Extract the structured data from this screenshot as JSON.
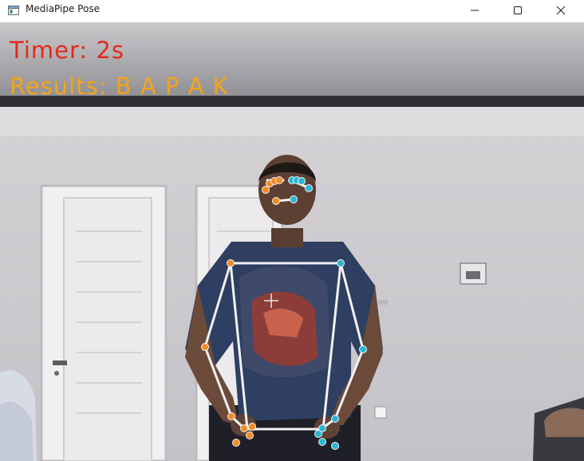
{
  "window": {
    "title": "MediaPipe Pose",
    "icon": "app-window-icon",
    "controls": [
      "minimize-icon",
      "maximize-icon",
      "close-icon"
    ]
  },
  "overlay": {
    "timer_text": "Timer: 2s",
    "results_text": "Results: B A P A K",
    "timer_color": "#e52a1b",
    "results_color": "#f2a419"
  },
  "pose": {
    "connection_color": "#f2f2f2",
    "left_landmark_color": "#f28c28",
    "right_landmark_color": "#2bb6d6"
  }
}
